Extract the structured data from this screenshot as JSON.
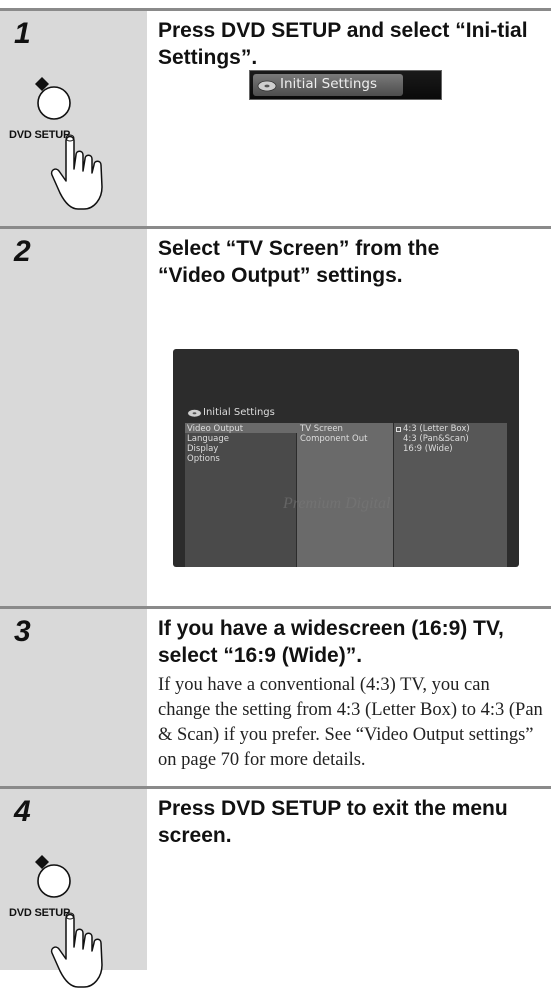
{
  "steps": [
    {
      "number": "1",
      "heading": "Press DVD SETUP and select “Ini-tial Settings”.",
      "button_label": "DVD SETUP",
      "osd": {
        "label": "Initial Settings"
      }
    },
    {
      "number": "2",
      "heading": "Select “TV Screen” from the “Video Output” settings.",
      "screen": {
        "title": "Initial Settings",
        "menu": [
          "Video Output",
          "Language",
          "Display",
          "Options"
        ],
        "submenu": [
          "TV Screen",
          "Component Out"
        ],
        "options": [
          "4:3 (Letter Box)",
          "4:3 (Pan&Scan)",
          "16:9 (Wide)"
        ],
        "watermark": "Premium Digital"
      }
    },
    {
      "number": "3",
      "heading": "If you have a widescreen (16:9) TV, select “16:9 (Wide)”.",
      "body": "If you have a conventional (4:3) TV, you can change the setting from 4:3 (Letter Box) to 4:3 (Pan & Scan) if you prefer. See “Video Output settings” on page 70 for more details."
    },
    {
      "number": "4",
      "heading": "Press DVD SETUP to exit the menu screen.",
      "button_label": "DVD SETUP"
    }
  ]
}
